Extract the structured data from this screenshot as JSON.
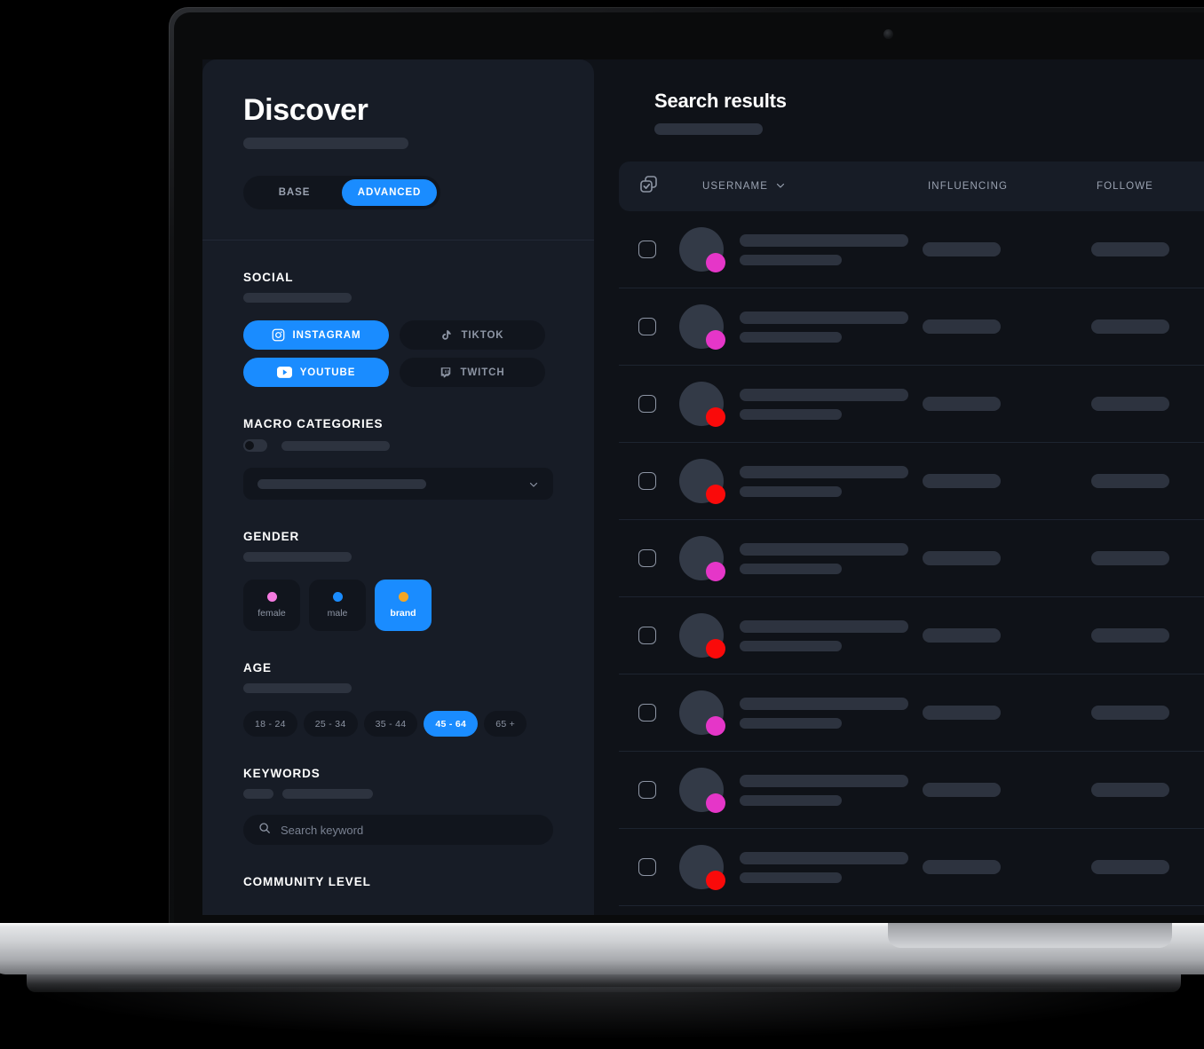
{
  "sidebar": {
    "title": "Discover",
    "mode_tabs": [
      {
        "label": "BASE",
        "active": false
      },
      {
        "label": "ADVANCED",
        "active": true
      }
    ],
    "groups": {
      "social": {
        "title": "SOCIAL",
        "options": [
          {
            "label": "INSTAGRAM",
            "icon": "instagram-icon",
            "active": true
          },
          {
            "label": "TIKTOK",
            "icon": "tiktok-icon",
            "active": false
          },
          {
            "label": "YOUTUBE",
            "icon": "youtube-icon",
            "active": true
          },
          {
            "label": "TWITCH",
            "icon": "twitch-icon",
            "active": false
          }
        ]
      },
      "macro_categories": {
        "title": "MACRO CATEGORIES",
        "toggle_on": false
      },
      "gender": {
        "title": "GENDER",
        "options": [
          {
            "label": "female",
            "dot_color": "#f57ae0",
            "active": false
          },
          {
            "label": "male",
            "dot_color": "#1a8cff",
            "active": false
          },
          {
            "label": "brand",
            "dot_color": "#f5a623",
            "active": true
          }
        ]
      },
      "age": {
        "title": "AGE",
        "options": [
          {
            "label": "18 - 24",
            "active": false
          },
          {
            "label": "25 - 34",
            "active": false
          },
          {
            "label": "35 - 44",
            "active": false
          },
          {
            "label": "45 - 64",
            "active": true
          },
          {
            "label": "65 +",
            "active": false
          }
        ]
      },
      "keywords": {
        "title": "KEYWORDS",
        "search_placeholder": "Search keyword",
        "search_value": ""
      },
      "community_level": {
        "title": "COMMUNITY LEVEL"
      }
    }
  },
  "results": {
    "title": "Search results",
    "columns": [
      {
        "key": "username",
        "label": "USERNAME",
        "sortable": true
      },
      {
        "key": "influencing",
        "label": "INFLUENCING",
        "sortable": false
      },
      {
        "key": "followers",
        "label": "FOLLOWE",
        "sortable": false
      }
    ],
    "rows": [
      {
        "checked": false,
        "badge_color": "#e536c8"
      },
      {
        "checked": false,
        "badge_color": "#e536c8"
      },
      {
        "checked": false,
        "badge_color": "#fa0a0a"
      },
      {
        "checked": false,
        "badge_color": "#fa0a0a"
      },
      {
        "checked": false,
        "badge_color": "#e536c8"
      },
      {
        "checked": false,
        "badge_color": "#fa0a0a"
      },
      {
        "checked": false,
        "badge_color": "#e536c8"
      },
      {
        "checked": false,
        "badge_color": "#e536c8"
      },
      {
        "checked": false,
        "badge_color": "#fa0a0a"
      }
    ]
  },
  "colors": {
    "accent": "#1a8cff",
    "panel": "#171c26",
    "screen_bg": "#0f1218",
    "skeleton": "#2d333f"
  }
}
